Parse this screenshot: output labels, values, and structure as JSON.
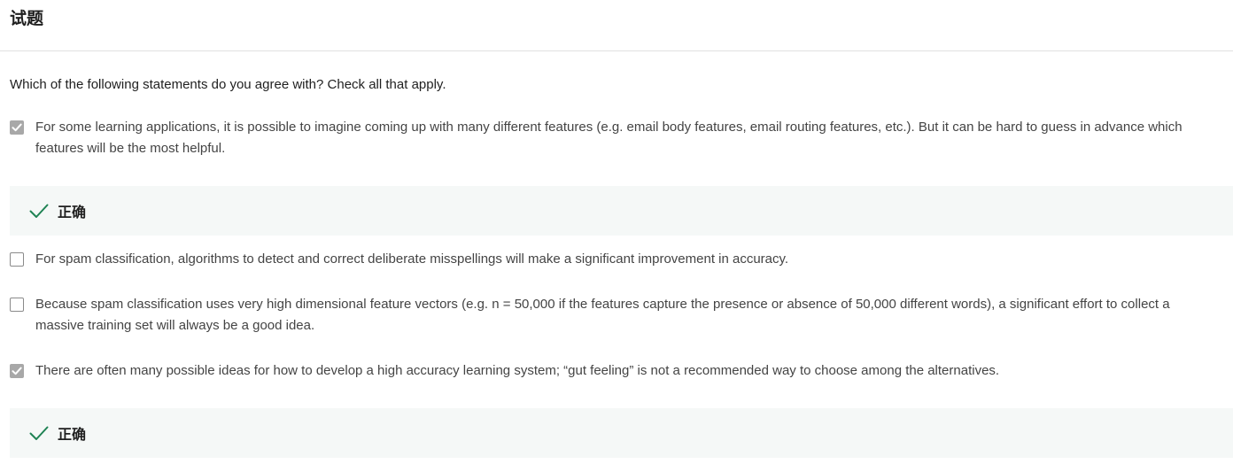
{
  "header": {
    "title": "试题"
  },
  "question": {
    "text": "Which of the following statements do you agree with? Check all that apply."
  },
  "options": [
    {
      "text": "For some learning applications, it is possible to imagine coming up with many different features (e.g. email body features, email routing features, etc.). But it can be hard to guess in advance which features will be the most helpful.",
      "checked": true,
      "feedback": "正确"
    },
    {
      "text": "For spam classification, algorithms to detect and correct deliberate misspellings will make a significant improvement in accuracy.",
      "checked": false
    },
    {
      "text": "Because spam classification uses very high dimensional feature vectors (e.g. n = 50,000 if the features capture the presence or absence of 50,000 different words), a significant effort to collect a massive training set will always be a good idea.",
      "checked": false
    },
    {
      "text": "There are often many possible ideas for how to develop a high accuracy learning system; “gut feeling” is not a recommended way to choose among the alternatives.",
      "checked": true,
      "feedback": "正确"
    }
  ],
  "colors": {
    "correct": "#1f8354",
    "feedback_bg": "#f5f8f7",
    "checked_box": "#a8a8a8"
  }
}
